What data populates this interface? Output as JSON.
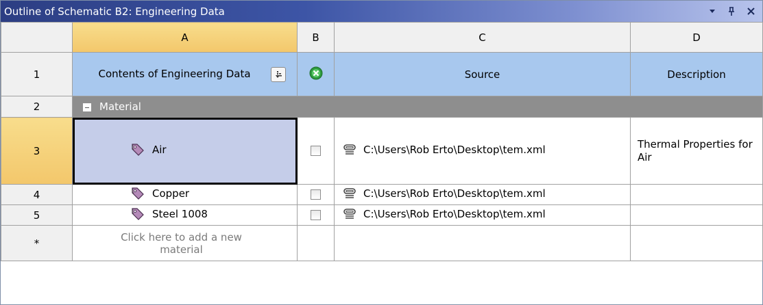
{
  "window": {
    "title": "Outline of Schematic B2: Engineering Data",
    "controls": [
      "▾",
      "ᵩ",
      "x"
    ]
  },
  "columns": [
    "A",
    "B",
    "C",
    "D"
  ],
  "header_row": {
    "number": "1",
    "contents": "Contents of Engineering Data",
    "source": "Source",
    "description": "Description"
  },
  "group_row": {
    "number": "2",
    "label": "Material"
  },
  "rows": [
    {
      "number": "3",
      "name": "Air",
      "checked": false,
      "source": "C:\\Users\\Rob Erto\\Desktop\\tem.xml",
      "description": "Thermal Properties for Air"
    },
    {
      "number": "4",
      "name": "Copper",
      "checked": false,
      "source": "C:\\Users\\Rob Erto\\Desktop\\tem.xml",
      "description": ""
    },
    {
      "number": "5",
      "name": "Steel 1008",
      "checked": false,
      "source": "C:\\Users\\Rob Erto\\Desktop\\tem.xml",
      "description": ""
    }
  ],
  "new_row": {
    "number": "*",
    "placeholder": "Click here to add a new material"
  },
  "colors": {
    "title_gradient_start": "#2c3e83",
    "header_blue": "#a8c8ee",
    "selected_col": "#f3c76b",
    "group_gray": "#8e8e8e",
    "selected_cell": "#c5cde9"
  }
}
